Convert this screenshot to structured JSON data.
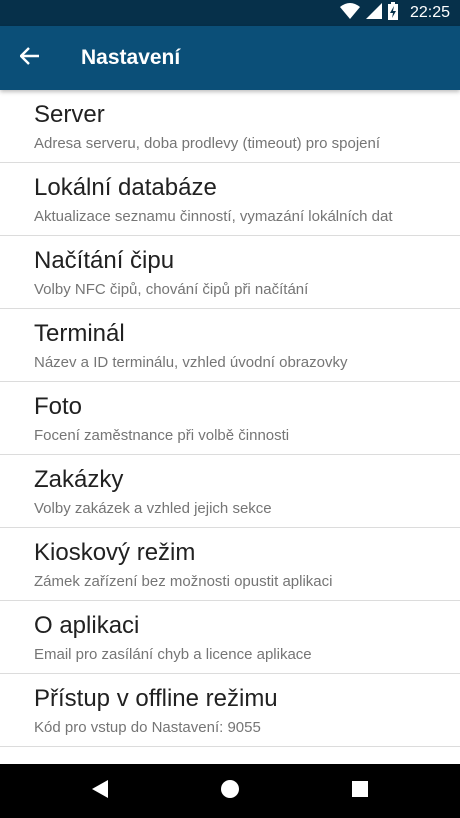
{
  "status_bar": {
    "time": "22:25",
    "icons": [
      "wifi-icon",
      "cell-signal-icon",
      "battery-charging-icon"
    ]
  },
  "app_bar": {
    "title": "Nastavení",
    "back_icon": "arrow-back-icon"
  },
  "settings": {
    "items": [
      {
        "title": "Server",
        "subtitle": "Adresa serveru, doba prodlevy (timeout) pro spojení"
      },
      {
        "title": "Lokální databáze",
        "subtitle": "Aktualizace seznamu činností, vymazání lokálních dat"
      },
      {
        "title": "Načítání čipu",
        "subtitle": "Volby NFC čipů, chování čipů při načítání"
      },
      {
        "title": "Terminál",
        "subtitle": "Název a ID terminálu, vzhled úvodní obrazovky"
      },
      {
        "title": "Foto",
        "subtitle": "Focení zaměstnance při volbě činnosti"
      },
      {
        "title": "Zakázky",
        "subtitle": "Volby zakázek a vzhled jejich sekce"
      },
      {
        "title": "Kioskový režim",
        "subtitle": "Zámek zařízení bez možnosti opustit aplikaci"
      },
      {
        "title": "O aplikaci",
        "subtitle": "Email pro zasílání chyb a licence aplikace"
      },
      {
        "title": "Přístup v offline režimu",
        "subtitle": "Kód pro vstup do Nastavení: 9055"
      }
    ]
  },
  "nav_bar": {
    "buttons": [
      "back-triangle-icon",
      "home-circle-icon",
      "recents-square-icon"
    ]
  },
  "colors": {
    "status_bar": "#06304a",
    "app_bar": "#0b4f78",
    "title_text": "#212121",
    "subtitle_text": "#757575"
  }
}
